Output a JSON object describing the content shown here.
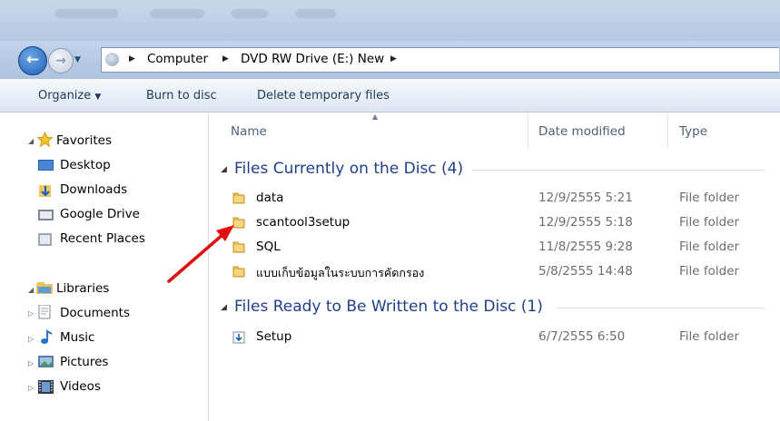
{
  "breadcrumb": {
    "items": [
      "Computer",
      "DVD RW Drive (E:) New"
    ]
  },
  "toolbar": {
    "organize_label": "Organize",
    "burn_label": "Burn to disc",
    "delete_label": "Delete temporary files"
  },
  "nav": {
    "favorites": {
      "header": "Favorites",
      "items": [
        "Desktop",
        "Downloads",
        "Google Drive",
        "Recent Places"
      ]
    },
    "libraries": {
      "header": "Libraries",
      "items": [
        "Documents",
        "Music",
        "Pictures",
        "Videos"
      ]
    }
  },
  "columns": {
    "name": "Name",
    "date": "Date modified",
    "type": "Type"
  },
  "groups": [
    {
      "title": "Files Currently on the Disc (4)",
      "rows": [
        {
          "name": "data",
          "date": "12/9/2555 5:21",
          "type": "File folder"
        },
        {
          "name": "scantool3setup",
          "date": "12/9/2555 5:18",
          "type": "File folder"
        },
        {
          "name": "SQL",
          "date": "11/8/2555 9:28",
          "type": "File folder"
        },
        {
          "name": "แบบเก็บข้อมูลในระบบการคัดกรอง",
          "date": "5/8/2555 14:48",
          "type": "File folder"
        }
      ]
    },
    {
      "title": "Files Ready to Be Written to the Disc (1)",
      "rows": [
        {
          "name": "Setup",
          "date": "6/7/2555 6:50",
          "type": "File folder"
        }
      ]
    }
  ],
  "colors": {
    "accent": "#1e3f8a",
    "annotation_arrow": "#e01010"
  }
}
